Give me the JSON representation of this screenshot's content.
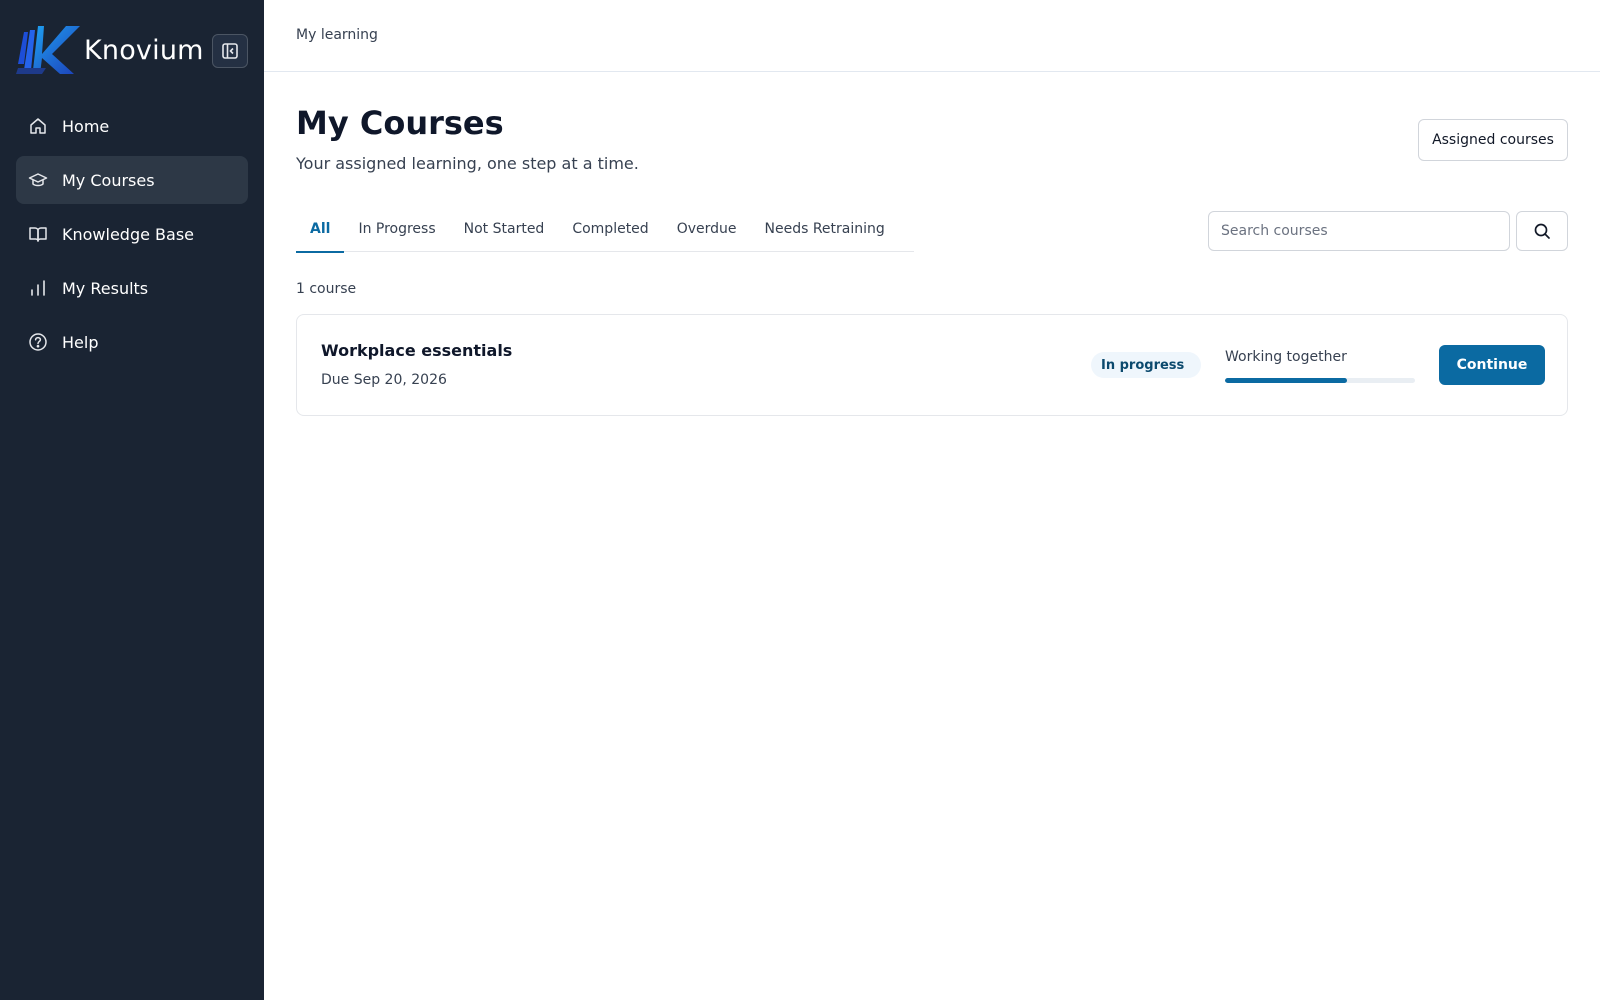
{
  "brand": {
    "name": "Knovium",
    "logo_icon": "knovium-logo"
  },
  "sidebar": {
    "collapse_icon": "sidebar-collapse-icon",
    "items": [
      {
        "label": "Home",
        "icon": "home-icon",
        "active": false
      },
      {
        "label": "My Courses",
        "icon": "graduation-cap-icon",
        "active": true
      },
      {
        "label": "Knowledge Base",
        "icon": "book-open-icon",
        "active": false
      },
      {
        "label": "My Results",
        "icon": "bar-chart-icon",
        "active": false
      },
      {
        "label": "Help",
        "icon": "help-circle-icon",
        "active": false
      }
    ]
  },
  "header": {
    "breadcrumb": "My learning"
  },
  "main": {
    "title": "My Courses",
    "subtitle": "Your assigned learning, one step at a time.",
    "assigned_button": "Assigned courses",
    "tabs": [
      {
        "label": "All",
        "active": true
      },
      {
        "label": "In Progress",
        "active": false
      },
      {
        "label": "Not Started",
        "active": false
      },
      {
        "label": "Completed",
        "active": false
      },
      {
        "label": "Overdue",
        "active": false
      },
      {
        "label": "Needs Retraining",
        "active": false
      }
    ],
    "search": {
      "placeholder": "Search courses",
      "value": ""
    },
    "count_text": "1 course",
    "courses": [
      {
        "title": "Workplace essentials",
        "due": "Due Sep 20, 2026",
        "status": "In progress",
        "progress_label": "Working together",
        "progress_percent": 64,
        "action_label": "Continue"
      }
    ]
  },
  "colors": {
    "sidebar_bg": "#1a2433",
    "sidebar_active": "#2d3846",
    "accent": "#0b6aa2",
    "badge_bg": "#eff6fc"
  }
}
